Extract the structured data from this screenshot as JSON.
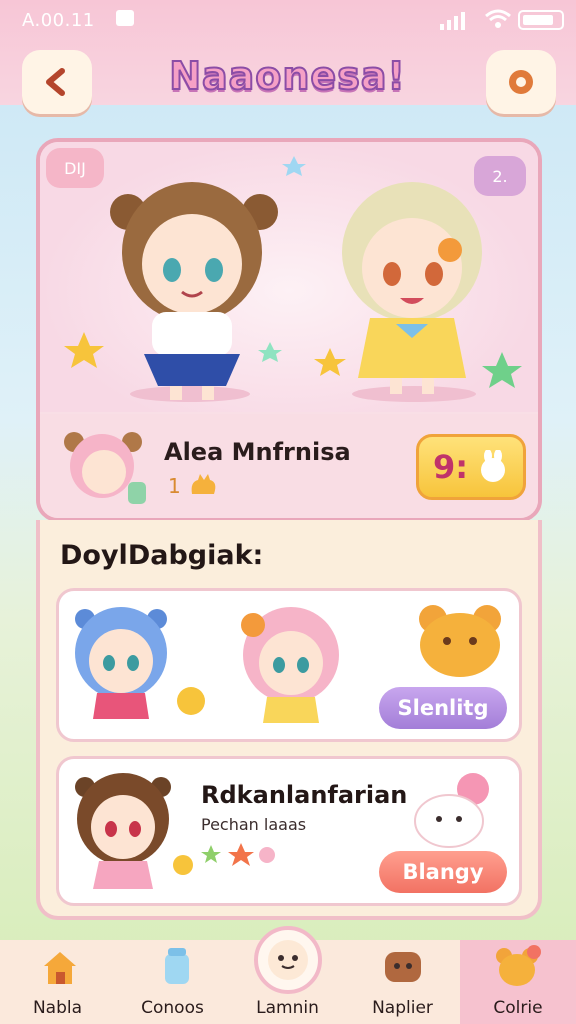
{
  "status_bar": {
    "time": "A.00.11"
  },
  "header": {
    "title": "Naaonesa!"
  },
  "hero": {
    "tag_left": "DIJ",
    "tag_right": "2.",
    "name": "Alea Mnfrnisa",
    "level": "1",
    "badge_text": "9:"
  },
  "section": {
    "title": "DoylDabgiak:"
  },
  "cards": [
    {
      "button": "Slenlitg"
    },
    {
      "name": "Rdkanlanfarian",
      "subtitle": "Pechan laaas",
      "button": "Blangy"
    }
  ],
  "nav": {
    "items": [
      {
        "label": "Nabla"
      },
      {
        "label": "Conoos"
      },
      {
        "label": "Lamnin"
      },
      {
        "label": "Naplier"
      },
      {
        "label": "Colrie"
      }
    ]
  },
  "colors": {
    "pink": "#f7c6d6",
    "accent_purple": "#a37ed8",
    "accent_coral": "#f27263",
    "gold": "#f7c43b"
  }
}
